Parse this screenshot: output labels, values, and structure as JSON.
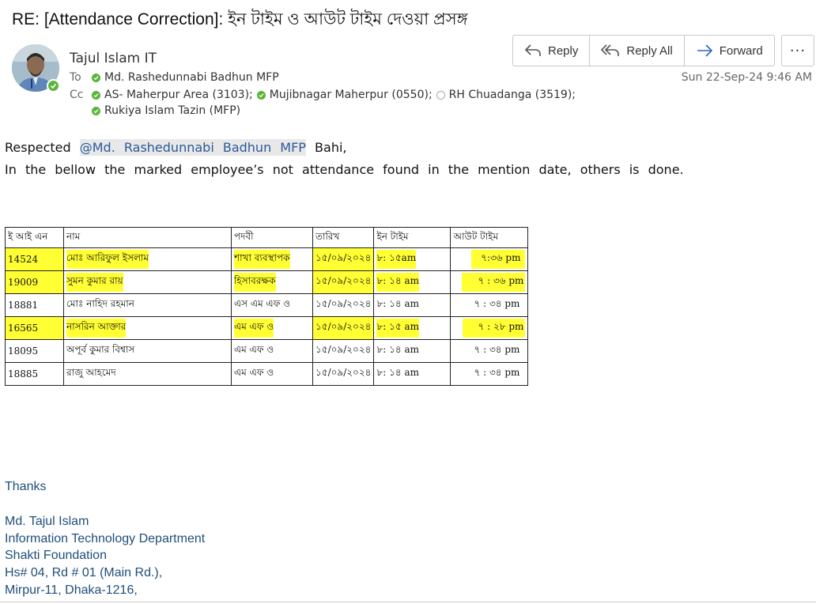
{
  "email": {
    "subject": "RE: [Attendance Correction]: ইন টাইম ও আউট টাইম দেওয়া প্রসঙ্গ",
    "sender": "Tajul Islam IT",
    "to_label": "To",
    "cc_label": "Cc",
    "to": [
      "Md. Rashedunnabi Badhun MFP"
    ],
    "cc_line1": [
      "AS- Maherpur Area (3103);",
      "Mujibnagar Maherpur (0550);",
      "RH Chuadanga (3519);"
    ],
    "cc_line2": [
      "Rukiya Islam Tazin (MFP)"
    ],
    "date": "Sun 22-Sep-24 9:46 AM"
  },
  "actions": {
    "reply": "Reply",
    "reply_all": "Reply All",
    "forward": "Forward",
    "more": "···"
  },
  "body": {
    "greeting_prefix": "Respected",
    "mention": "@Md. Rashedunnabi Badhun MFP",
    "greeting_suffix": "Bahi,",
    "line2": "In the bellow the marked employee’s not attendance found in the mention date, others is done."
  },
  "table": {
    "headers": [
      "ই আই এন",
      "নাম",
      "পদবী",
      "তারিখ",
      "ইন টাইম",
      "আউট টাইম"
    ],
    "rows": [
      [
        "14524",
        "মোঃ আরিফুল ইসলাম",
        "শাখা ব্যবস্থাপক",
        "১৫/০৯/২০২৪",
        "৮: ১৫am",
        "৭:৩৬ pm"
      ],
      [
        "19009",
        "সুমন কুমার রায়",
        "হিসাবরক্ষক",
        "১৫/০৯/২০২৪",
        "৮: ১৪ am",
        "৭ : ৩৬ pm"
      ],
      [
        "18881",
        "মোঃ নাহিদ রহমান",
        "এস এম এফ ও",
        "১৫/০৯/২০২৪",
        "৮: ১৪ am",
        "৭ : ৩৪ pm"
      ],
      [
        "16565",
        "নাসরিন আক্তার",
        "এম এফ ও",
        "১৫/০৯/২০২৪",
        "৮: ১৫ am",
        "৭ : ২৮ pm"
      ],
      [
        "18095",
        "অপূর্ব কুমার বিশ্বাস",
        "এম এফ ও",
        "১৫/০৯/২০২৪",
        "৮: ১৪ am",
        "৭ : ৩৪ pm"
      ],
      [
        "18885",
        "রাজু আহমেদ",
        "এম এফ ও",
        "১৫/০৯/২০২৪",
        "৮: ১৪ am",
        "৭ : ৩৪ pm"
      ]
    ],
    "highlight_color": "#ffff33"
  },
  "signature": {
    "thanks": "Thanks",
    "name": "Md. Tajul Islam",
    "department": "Information Technology Department",
    "org": "Shakti Foundation",
    "address1": "Hs# 04, Rd # 01 (Main Rd.),",
    "address2": "Mirpur-11, Dhaka-1216,"
  }
}
